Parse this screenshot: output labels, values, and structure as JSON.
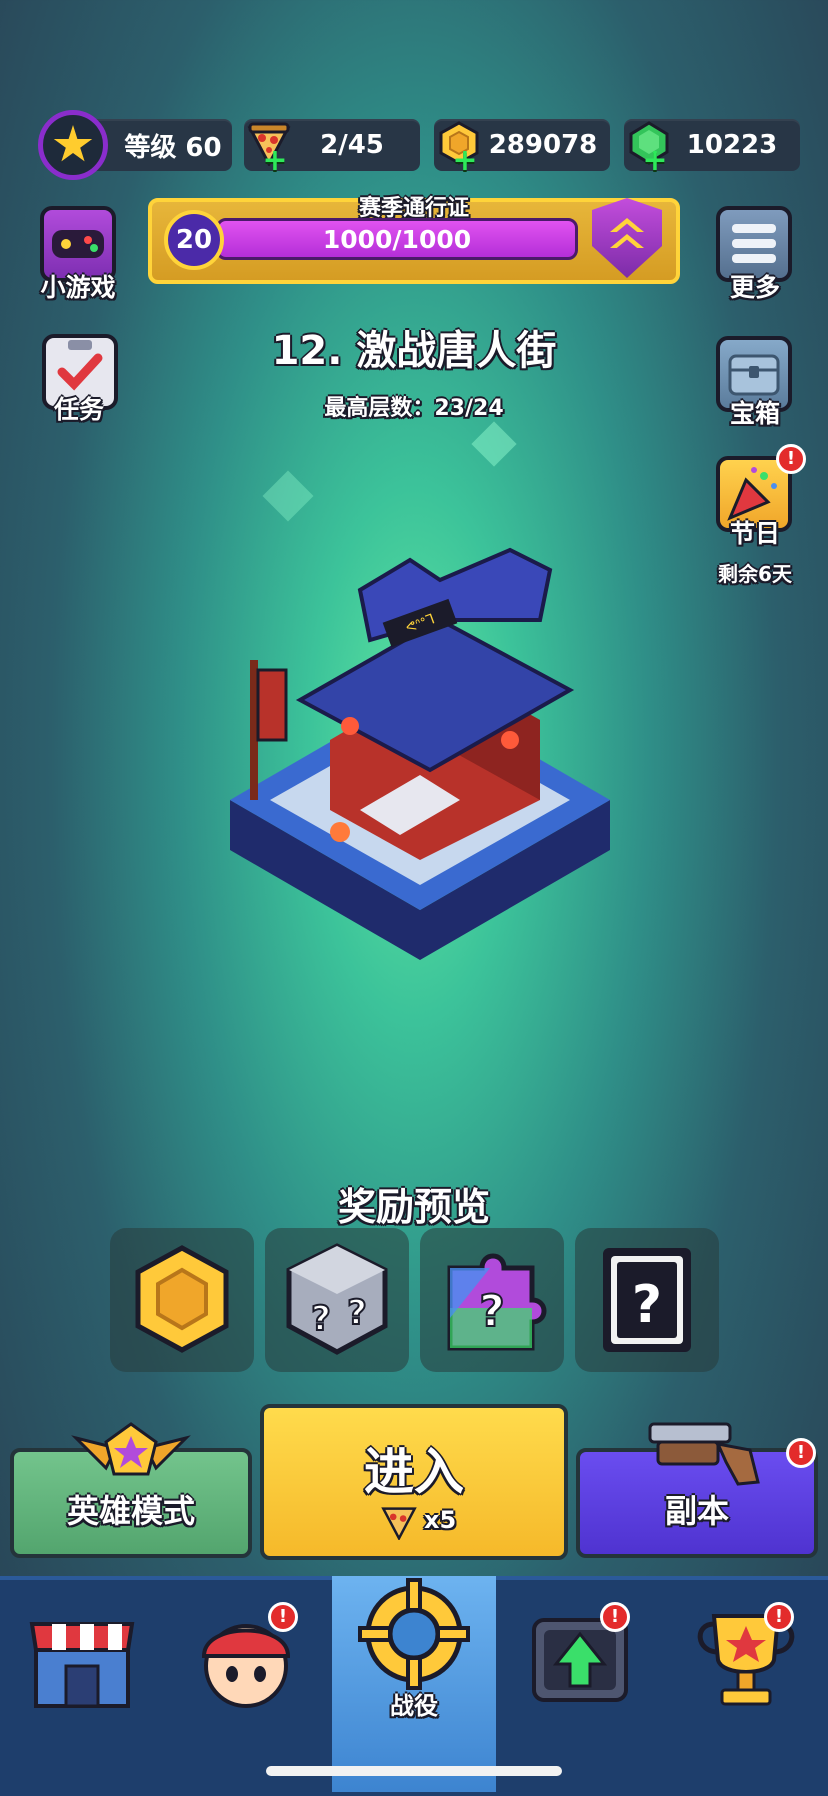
{
  "top_bar": {
    "level_text": "等级 60",
    "pizza_energy": "2/45",
    "coins": "289078",
    "gems": "10223"
  },
  "season_pass": {
    "title": "赛季通行证",
    "level": "20",
    "progress_text": "1000/1000",
    "progress_fraction": 1.0
  },
  "side_left": {
    "minigame_label": "小游戏",
    "tasks_label": "任务"
  },
  "side_right": {
    "more_label": "更多",
    "chest_label": "宝箱",
    "festival_label": "节日",
    "festival_remaining": "剩余6天"
  },
  "stage": {
    "title": "12. 激战唐人街",
    "max_floors": "最高层数：23/24",
    "sign_text": "ᕙᐢᐤᒣ"
  },
  "rewards": {
    "title": "奖励预览",
    "items": [
      "coin-icon",
      "mystery-dice-icon",
      "mystery-puzzle-icon",
      "mystery-card-icon"
    ],
    "dice_mark": "?",
    "puzzle_mark": "?",
    "card_mark": "?"
  },
  "actions": {
    "hero_mode_label": "英雄模式",
    "enter_label": "进入",
    "enter_cost": "x5",
    "dungeon_label": "副本"
  },
  "nav": {
    "items": [
      "shop-icon",
      "hero-icon",
      "campaign-icon",
      "upgrade-icon",
      "trophy-icon"
    ],
    "active_label": "战役"
  },
  "alerts": {
    "mark": "!"
  },
  "colors": {
    "accent_yellow": "#f5b92a",
    "hero_green": "#53a56e",
    "dungeon_purple": "#4f33d0",
    "nav_blue": "#1e3e6c",
    "alert_red": "#e32b2b",
    "level_ring": "#8a2dcc"
  }
}
